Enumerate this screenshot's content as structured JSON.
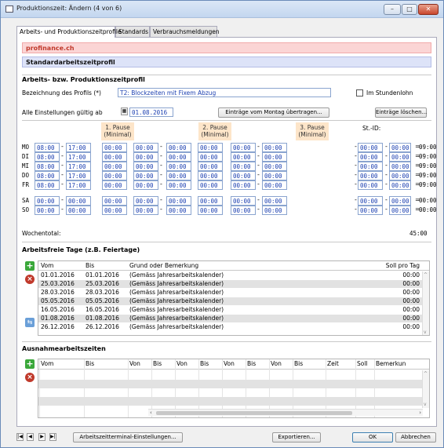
{
  "window": {
    "title": "Produktionszeit: Ändern (4 von 6)",
    "minimize": "–",
    "maximize": "□",
    "close": "✕"
  },
  "tabs": [
    "Arbeits- und Produktionszeitprofile",
    "Standards",
    "Verbrauchsmeldungen"
  ],
  "banner": {
    "company": "profinance.ch",
    "section": "Standardarbeitszeitprofil"
  },
  "profile": {
    "group_title": "Arbeits- bzw. Produktionszeitprofil",
    "name_label": "Bezeichnung des Profils (*)",
    "name_value": "T2: Blockzeiten mit Fixem Abzug",
    "hourly_label": "Im Stundenlohn",
    "valid_label": "Alle Einstellungen gültig ab",
    "valid_date": "01.08.2016",
    "copy_button": "Einträge vom Montag übertragen...",
    "delete_button": "Einträge löschen...",
    "pause1": "1. Pause\n(Minimal)",
    "pause2": "2. Pause\n(Minimal)",
    "pause3": "3. Pause\n(Minimal)",
    "stid_label": "St.-ID:",
    "dash": "-",
    "equals": "=",
    "days": [
      {
        "day": "MO",
        "t": [
          "08:00",
          "17:00",
          "00:00",
          "00:00",
          "00:00",
          "00:00",
          "00:00",
          "00:00",
          "00:00",
          "00:00"
        ],
        "total": "09:00"
      },
      {
        "day": "DI",
        "t": [
          "08:00",
          "17:00",
          "00:00",
          "00:00",
          "00:00",
          "00:00",
          "00:00",
          "00:00",
          "00:00",
          "00:00"
        ],
        "total": "09:00"
      },
      {
        "day": "MI",
        "t": [
          "08:00",
          "17:00",
          "00:00",
          "00:00",
          "00:00",
          "00:00",
          "00:00",
          "00:00",
          "00:00",
          "00:00"
        ],
        "total": "09:00"
      },
      {
        "day": "DO",
        "t": [
          "08:00",
          "17:00",
          "00:00",
          "00:00",
          "00:00",
          "00:00",
          "00:00",
          "00:00",
          "00:00",
          "00:00"
        ],
        "total": "09:00"
      },
      {
        "day": "FR",
        "t": [
          "08:00",
          "17:00",
          "00:00",
          "00:00",
          "00:00",
          "00:00",
          "00:00",
          "00:00",
          "00:00",
          "00:00"
        ],
        "total": "09:00"
      },
      {
        "day": "SA",
        "t": [
          "00:00",
          "00:00",
          "00:00",
          "00:00",
          "00:00",
          "00:00",
          "00:00",
          "00:00",
          "00:00",
          "00:00"
        ],
        "total": "00:00"
      },
      {
        "day": "SO",
        "t": [
          "00:00",
          "00:00",
          "00:00",
          "00:00",
          "00:00",
          "00:00",
          "00:00",
          "00:00",
          "00:00",
          "00:00"
        ],
        "total": "00:00"
      }
    ],
    "week_total_label": "Wochentotal:",
    "week_total": "45:00"
  },
  "holidays": {
    "title": "Arbeitsfreie Tage (z.B. Feiertage)",
    "headers": [
      "Vom",
      "Bis",
      "Grund oder Bemerkung",
      "Soll pro Tag"
    ],
    "rows": [
      [
        "01.01.2016",
        "01.01.2016",
        "(Gemäss Jahresarbeitskalender)",
        "00:00"
      ],
      [
        "25.03.2016",
        "25.03.2016",
        "(Gemäss Jahresarbeitskalender)",
        "00:00"
      ],
      [
        "28.03.2016",
        "28.03.2016",
        "(Gemäss Jahresarbeitskalender)",
        "00:00"
      ],
      [
        "05.05.2016",
        "05.05.2016",
        "(Gemäss Jahresarbeitskalender)",
        "00:00"
      ],
      [
        "16.05.2016",
        "16.05.2016",
        "(Gemäss Jahresarbeitskalender)",
        "00:00"
      ],
      [
        "01.08.2016",
        "01.08.2016",
        "(Gemäss Jahresarbeitskalender)",
        "00:00"
      ],
      [
        "26.12.2016",
        "26.12.2016",
        "(Gemäss Jahresarbeitskalender)",
        "00:00"
      ]
    ]
  },
  "exceptions": {
    "title": "Ausnahmearbeitszeiten",
    "headers": [
      "Vom",
      "Bis",
      "Von",
      "Bis",
      "Von",
      "Bis",
      "Von",
      "Bis",
      "Von",
      "Bis",
      "Zeit",
      "Soll",
      "Bemerkun"
    ]
  },
  "footer": {
    "nav": [
      "|◀",
      "◀",
      "▶",
      "▶|"
    ],
    "terminal_button": "Arbeitszeitterminal-Einstellungen...",
    "export_button": "Exportieren...",
    "ok_button": "OK",
    "cancel_button": "Abbrechen"
  }
}
